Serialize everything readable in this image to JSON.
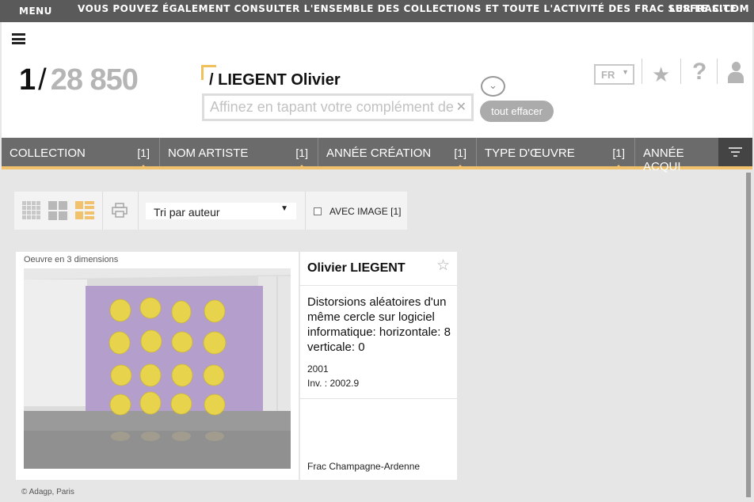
{
  "topbar": {
    "menu": "MENU",
    "message": "VOUS POUVEZ ÉGALEMENT CONSULTER L'ENSEMBLE DES COLLECTIONS ET TOUTE L'ACTIVITÉ DES FRAC SUR LE SITE",
    "site": "LESFRAC.COM"
  },
  "header": {
    "current": "1",
    "separator": "/",
    "total": "28 850",
    "query": "/ LIEGENT Olivier",
    "search_placeholder": "Affinez en tapant votre complément de",
    "clear_all": "tout effacer",
    "language": "FR"
  },
  "filters": [
    {
      "label": "COLLECTION",
      "count": "[1]"
    },
    {
      "label": "NOM ARTISTE",
      "count": "[1]"
    },
    {
      "label": "ANNÉE CRÉATION",
      "count": "[1]"
    },
    {
      "label": "TYPE D'ŒUVRE",
      "count": "[1]"
    },
    {
      "label": "ANNÉE ACQUI",
      "count": ""
    }
  ],
  "toolbar": {
    "sort": "Tri par auteur",
    "with_image": "AVEC IMAGE [1]",
    "with_image_checked": false
  },
  "result": {
    "type": "Oeuvre en 3 dimensions",
    "artist": "Olivier LIEGENT",
    "title": "Distorsions aléatoires d'un même cercle sur logiciel informatique: horizontale: 8 verticale: 0",
    "year": "2001",
    "inventory": "Inv. : 2002.9",
    "collection": "Frac Champagne-Ardenne"
  },
  "credit": "© Adagp, Paris",
  "colors": {
    "accent": "#f1c16b",
    "filter_bar": "#6b6b6b",
    "topbar": "#5a5a5a",
    "artwork_wall": "#b49fcc",
    "artwork_disc": "#e8d34d"
  }
}
